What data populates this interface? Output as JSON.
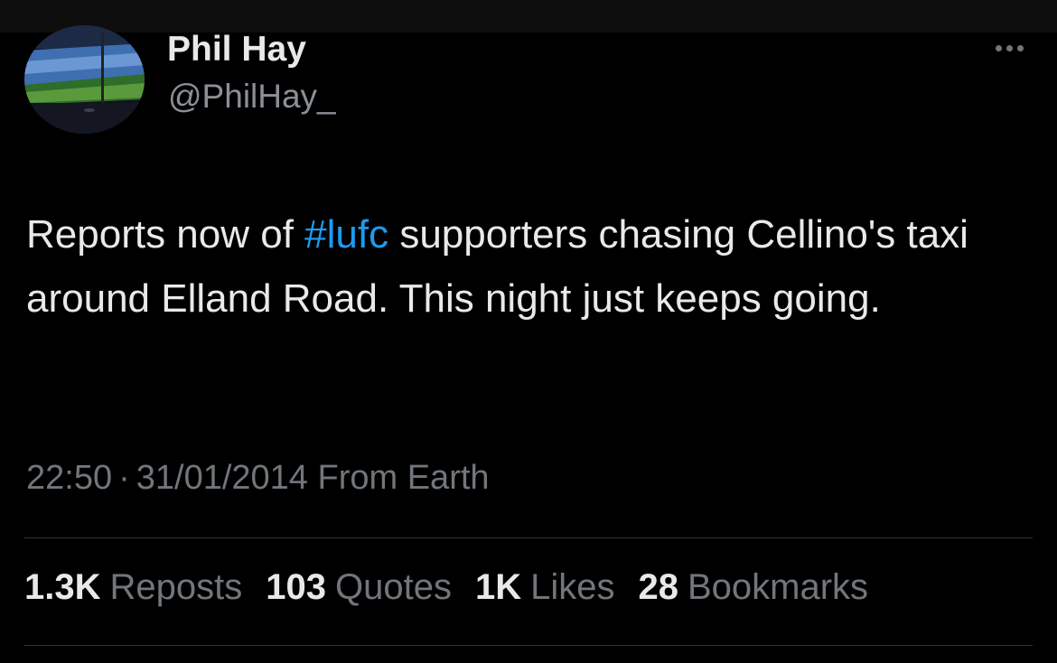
{
  "author": {
    "display_name": "Phil Hay",
    "handle": "@PhilHay_",
    "avatar_icon": "stadium-photo-avatar"
  },
  "menu": {
    "more_icon": "more-horizontal-icon"
  },
  "tweet": {
    "text_before": "Reports now of ",
    "hashtag": "#lufc",
    "text_after": " supporters chasing Cellino's taxi around Elland Road. This night just keeps going."
  },
  "meta": {
    "time": "22:50",
    "separator": "·",
    "date": "31/01/2014",
    "source": "From Earth"
  },
  "stats": {
    "reposts": {
      "count": "1.3K",
      "label": "Reposts"
    },
    "quotes": {
      "count": "103",
      "label": "Quotes"
    },
    "likes": {
      "count": "1K",
      "label": "Likes"
    },
    "bookmarks": {
      "count": "28",
      "label": "Bookmarks"
    }
  },
  "colors": {
    "background": "#000000",
    "text_primary": "#e7e9ea",
    "text_secondary": "#71767b",
    "link": "#1d9bf0",
    "divider": "#2f3336"
  }
}
